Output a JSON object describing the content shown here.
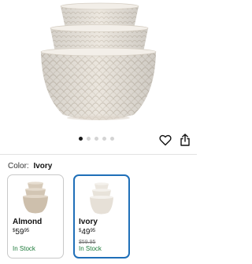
{
  "product": {
    "image_alt": "stacked textured ceramic bowls"
  },
  "carousel": {
    "total_dots": 5,
    "active_index": 0
  },
  "actions": {
    "favorite_icon": "heart-icon",
    "share_icon": "share-icon"
  },
  "color": {
    "label": "Color:",
    "selected": "Ivory"
  },
  "variants": [
    {
      "name": "Almond",
      "price_currency": "$",
      "price_dollars": "59",
      "price_cents": "95",
      "was_price": "",
      "stock": "In Stock",
      "selected": false
    },
    {
      "name": "Ivory",
      "price_currency": "$",
      "price_dollars": "49",
      "price_cents": "95",
      "was_price": "$59.95",
      "stock": "In Stock",
      "selected": true
    }
  ],
  "colors": {
    "accent": "#1f6fb8",
    "stock": "#1d7a3a",
    "bowl": "#ece7df",
    "almond": "#d9cdbd"
  }
}
